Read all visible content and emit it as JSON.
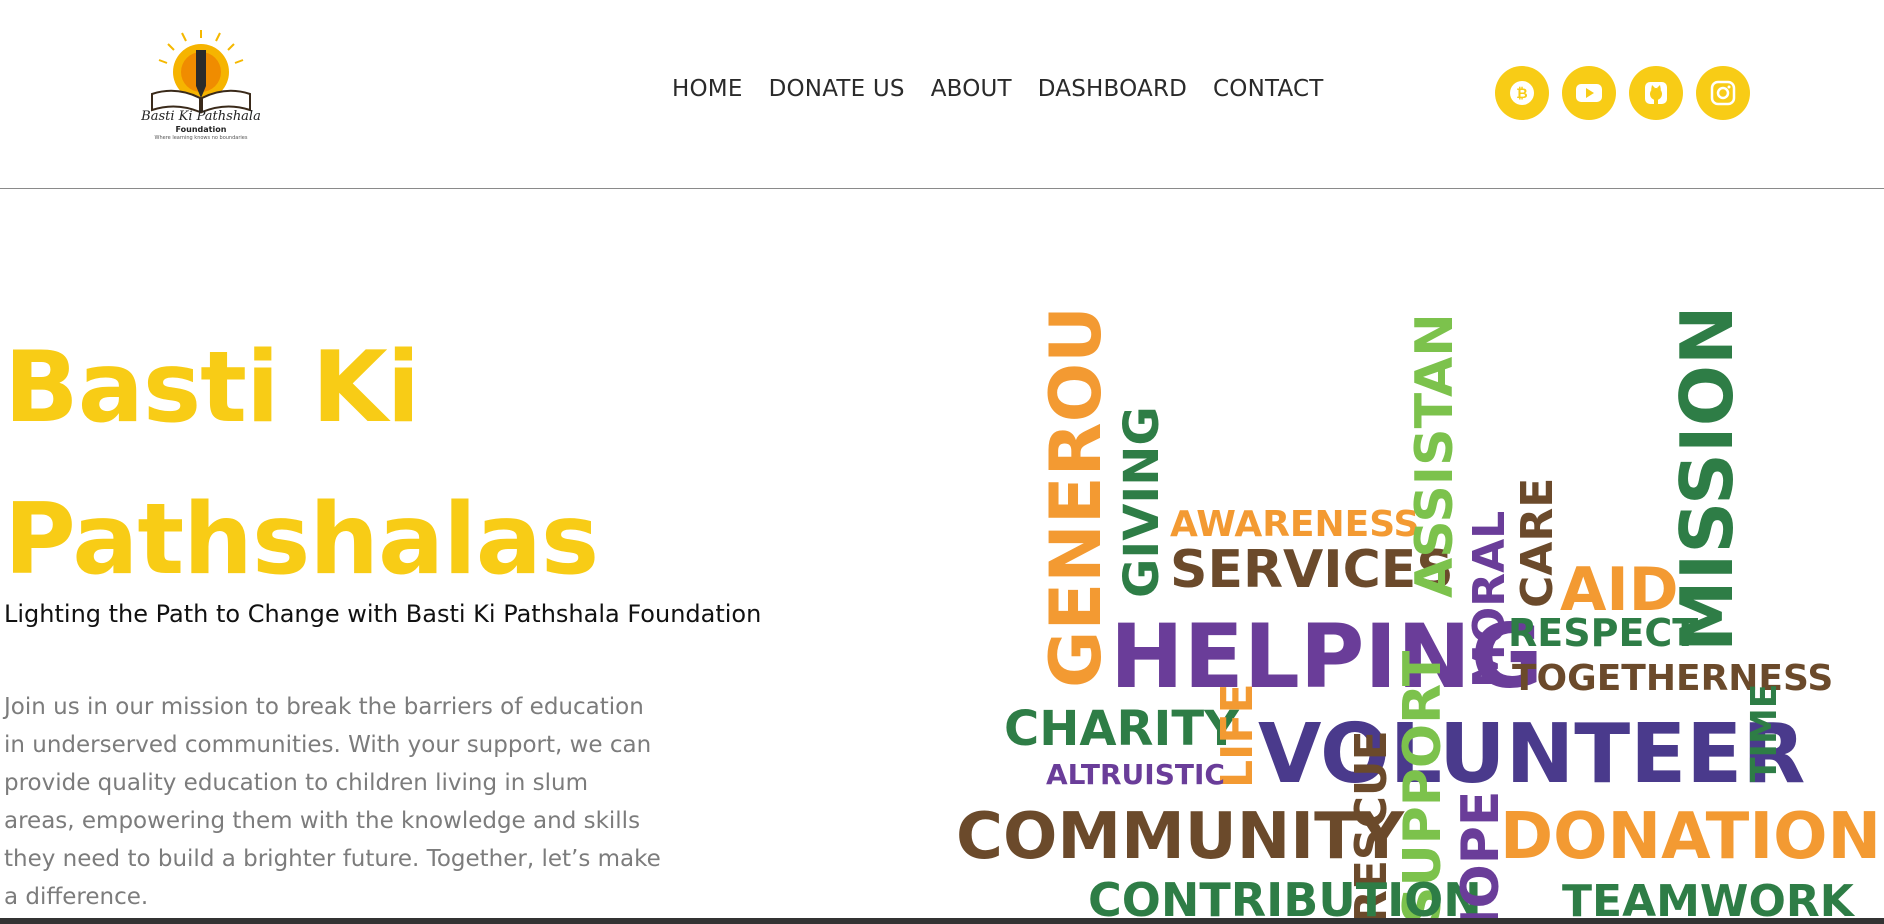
{
  "header": {
    "logo": {
      "title": "Basti Ki Pathshala",
      "subtitle": "Foundation",
      "tagline": "Where learning knows no boundaries"
    },
    "nav": [
      {
        "label": "HOME"
      },
      {
        "label": "DONATE US"
      },
      {
        "label": "ABOUT"
      },
      {
        "label": "DASHBOARD"
      },
      {
        "label": "CONTACT"
      }
    ],
    "socials": [
      {
        "icon": "bitcoin-icon"
      },
      {
        "icon": "youtube-icon"
      },
      {
        "icon": "github-icon"
      },
      {
        "icon": "instagram-icon"
      }
    ]
  },
  "hero": {
    "title_line1": "Basti Ki",
    "title_line2": "Pathshalas",
    "subtitle": "Lighting the Path to Change with Basti Ki Pathshala Foundation",
    "description": "Join us in our mission to break the barriers of education in underserved communities. With your support, we can provide quality education to children living in slum areas, empowering them with the knowledge and skills they need to build a brighter future. Together, let’s make a difference."
  },
  "word_cloud": {
    "words": [
      "GENEROUS",
      "GIVING",
      "AWARENESS",
      "SERVICES",
      "ASSISTANCE",
      "MORAL",
      "CARE",
      "AID",
      "MISSION",
      "HELPING",
      "RESPECT",
      "TOGETHERNESS",
      "CHARITY",
      "LIFE",
      "VOLUNTEER",
      "TIME",
      "ALTRUISTIC",
      "COMMUNITY",
      "RESCUE",
      "SUPPORT",
      "DONATIONS",
      "CONTRIBUTION",
      "HOPE",
      "TEAMWORK"
    ]
  },
  "colors": {
    "accent": "#f8cc16",
    "orange": "#f39a32",
    "green": "#2e7d46",
    "light_green": "#7cc24c",
    "purple": "#6a3d99",
    "brown": "#6b4a2b"
  }
}
